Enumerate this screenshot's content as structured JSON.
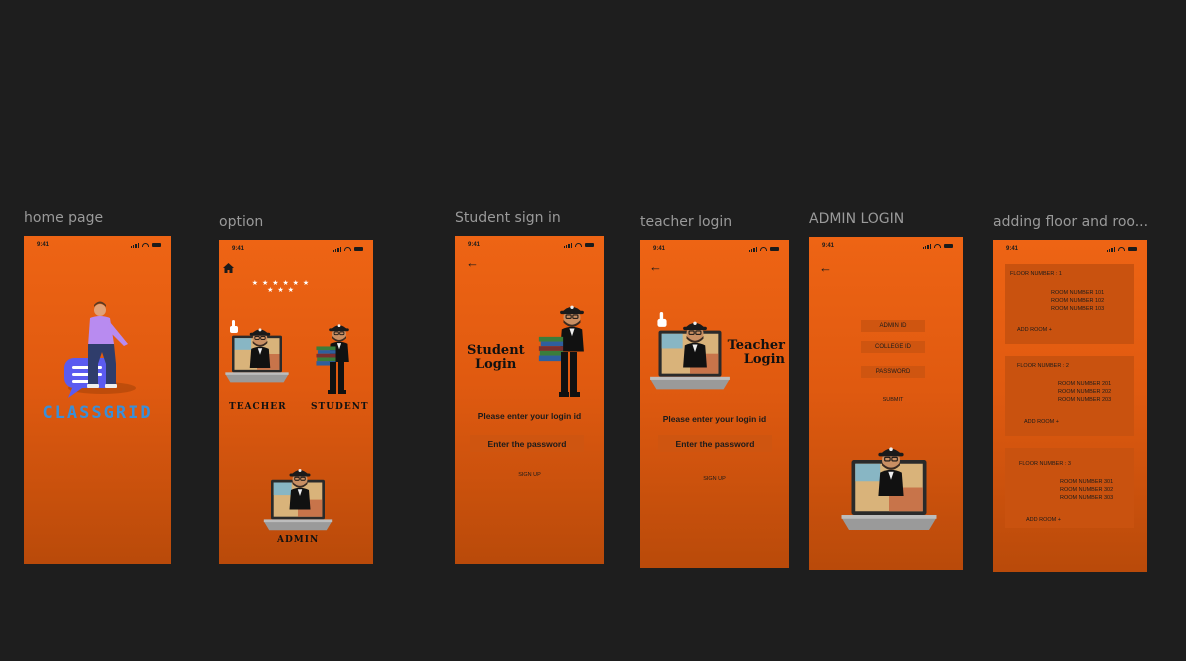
{
  "status_time": "9:41",
  "frames": {
    "home": {
      "label": "home  page",
      "brand": "CLASSGRID"
    },
    "option": {
      "label": "option",
      "teacher": "TEACHER",
      "student": "STUDENT",
      "admin": "ADMIN",
      "stars": "★ ★ ★ ★ ★ ★ ★ ★ ★"
    },
    "student": {
      "label": "Student sign in",
      "title_line1": "Student",
      "title_line2": "Login",
      "login_prompt": "Please enter your login id",
      "password_prompt": "Enter the password",
      "signup": "SIGN UP"
    },
    "teacher": {
      "label": "teacher login",
      "title_line1": "Teacher",
      "title_line2": "Login",
      "login_prompt": "Please enter your login id",
      "password_prompt": "Enter the password",
      "signup": "SIGN UP"
    },
    "admin": {
      "label": "ADMIN LOGIN",
      "admin_id": "ADMIN ID",
      "college_id": "COLLEGE ID",
      "password": "PASSWORD",
      "submit": "SUBMIT"
    },
    "floors": {
      "label": "adding floor and roo...",
      "cards": [
        {
          "title": "FLOOR NUMBER : 1",
          "rooms": [
            "ROOM NUMBER 101",
            "ROOM NUMBER 102",
            "ROOM NUMBER 103"
          ],
          "add": "ADD ROOM +"
        },
        {
          "title": "FLOOR NUMBER : 2",
          "rooms": [
            "ROOM NUMBER 201",
            "ROOM NUMBER 202",
            "ROOM NUMBER 203"
          ],
          "add": "ADD ROOM +"
        },
        {
          "title": "FLOOR NUMBER : 3",
          "rooms": [
            "ROOM NUMBER 301",
            "ROOM NUMBER 302",
            "ROOM NUMBER 303"
          ],
          "add": "ADD ROOM +"
        }
      ]
    }
  },
  "colors": {
    "canvas": "#1e1e1e",
    "screen_orange": "#ee6414",
    "brand_blue": "#3a8fd8",
    "input_bg": "#cf5510"
  }
}
